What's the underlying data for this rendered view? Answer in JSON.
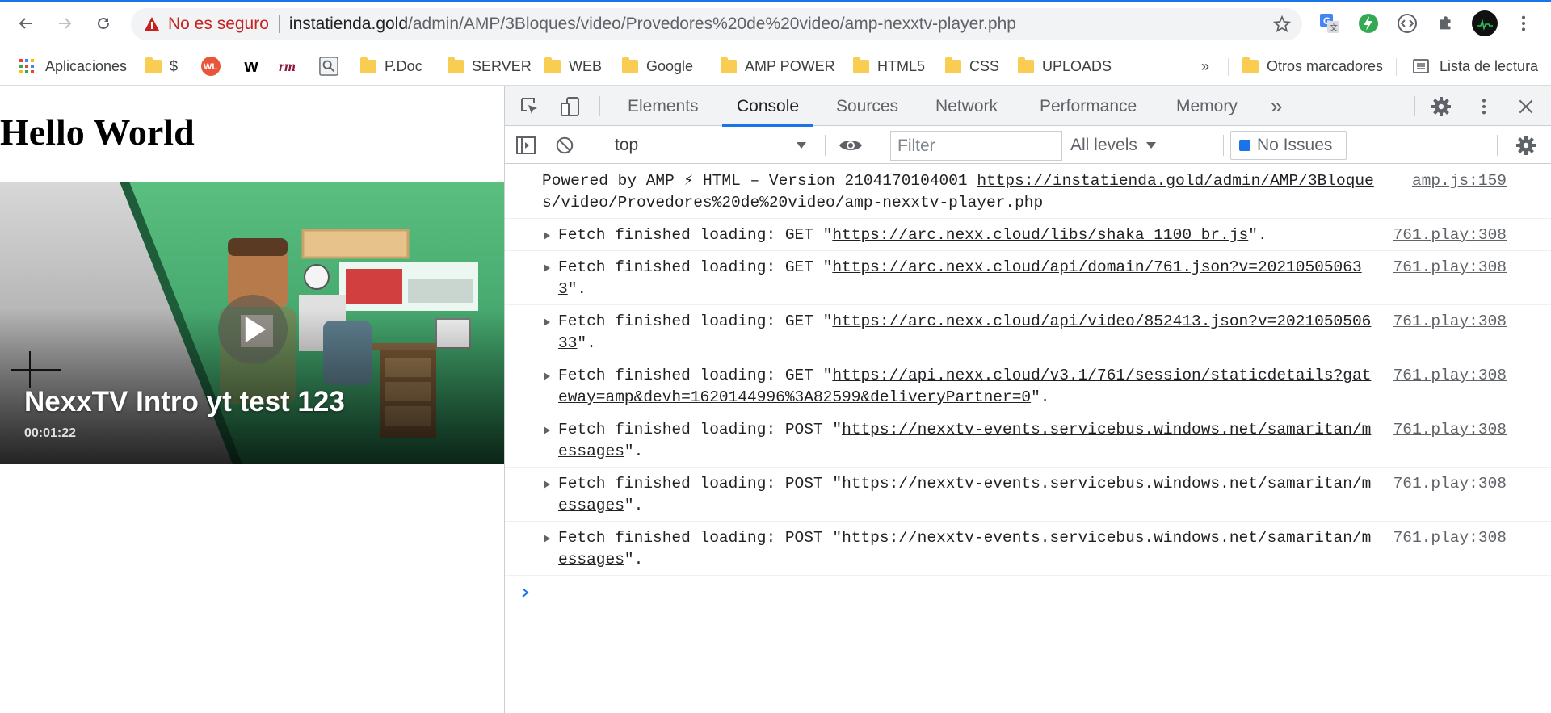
{
  "browser": {
    "insecure_label": "No es seguro",
    "url_host": "instatienda.gold",
    "url_path": "/admin/AMP/3Bloques/video/Provedores%20de%20video/amp-nexxtv-player.php",
    "accent_color": "#1a73e8"
  },
  "bookmarks": {
    "apps": "Aplicaciones",
    "dollar": "$",
    "w": "w",
    "pdoc": "P.Doc",
    "server": "SERVER",
    "web": "WEB",
    "google": "Google",
    "amp_power": "AMP POWER",
    "html5": "HTML5",
    "css": "CSS",
    "uploads": "UPLOADS",
    "more": "»",
    "others": "Otros marcadores",
    "reading_list": "Lista de lectura"
  },
  "page": {
    "heading": "Hello World",
    "video_title": "NexxTV Intro yt test 123",
    "video_duration": "00:01:22"
  },
  "devtools": {
    "tabs": [
      "Elements",
      "Console",
      "Sources",
      "Network",
      "Performance",
      "Memory"
    ],
    "more_tabs": "»",
    "context": "top",
    "filter_placeholder": "Filter",
    "levels": "All levels",
    "issues": "No Issues",
    "logs": [
      {
        "text_pre": "Powered by AMP ⚡ HTML – Version 2104170104001 ",
        "link": "https://instatienda.gold/admin/AMP/3Bloques/video/Provedores%20de%20video/amp-nexxtv-player.php",
        "text_post": "",
        "source": "amp.js:159"
      },
      {
        "text_pre": "Fetch finished loading: GET \"",
        "link": "https://arc.nexx.cloud/libs/shaka_1100_br.js",
        "text_post": "\".",
        "source": "761.play:308"
      },
      {
        "text_pre": "Fetch finished loading: GET \"",
        "link": "https://arc.nexx.cloud/api/domain/761.json?v=202105050633",
        "text_post": "\".",
        "source": "761.play:308"
      },
      {
        "text_pre": "Fetch finished loading: GET \"",
        "link": "https://arc.nexx.cloud/api/video/852413.json?v=202105050633",
        "text_post": "\".",
        "source": "761.play:308"
      },
      {
        "text_pre": "Fetch finished loading: GET \"",
        "link": "https://api.nexx.cloud/v3.1/761/session/staticdetails?gateway=amp&devh=1620144996%3A82599&deliveryPartner=0",
        "text_post": "\".",
        "source": "761.play:308"
      },
      {
        "text_pre": "Fetch finished loading: POST \"",
        "link": "https://nexxtv-events.servicebus.windows.net/samaritan/messages",
        "text_post": "\".",
        "source": "761.play:308"
      },
      {
        "text_pre": "Fetch finished loading: POST \"",
        "link": "https://nexxtv-events.servicebus.windows.net/samaritan/messages",
        "text_post": "\".",
        "source": "761.play:308"
      },
      {
        "text_pre": "Fetch finished loading: POST \"",
        "link": "https://nexxtv-events.servicebus.windows.net/samaritan/messages",
        "text_post": "\".",
        "source": "761.play:308"
      }
    ]
  }
}
